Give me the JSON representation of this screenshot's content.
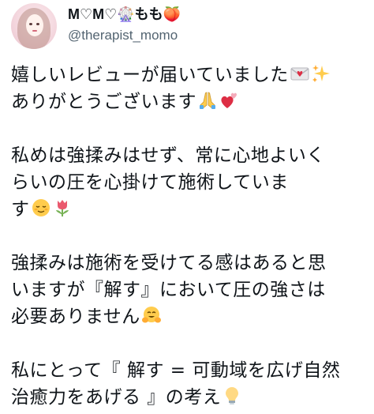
{
  "user": {
    "display_name": "M♡M♡🎡もも🍑",
    "handle": "@therapist_momo"
  },
  "tweet": {
    "lines": [
      "嬉しいレビューが届いていました",
      "ありがとうございます",
      "私めは強揉みはせず、常に心地よいく",
      "らいの圧を心掛けて施術していま",
      "す",
      "強揉みは施術を受けてる感はあると思",
      "いますが『解す』において圧の強さは",
      "必要ありません",
      "私にとって『 解す = 可動域を広げ自然",
      "治癒力をあげる 』の考え"
    ],
    "emojis": {
      "line1": [
        "envelope-heart-icon",
        "sparkles-icon"
      ],
      "line2": [
        "folded-hands-icon",
        "two-hearts-icon"
      ],
      "line5": [
        "relieved-face-icon",
        "tulip-icon"
      ],
      "line8": [
        "hugging-face-icon"
      ],
      "line10": [
        "light-bulb-icon"
      ]
    }
  }
}
